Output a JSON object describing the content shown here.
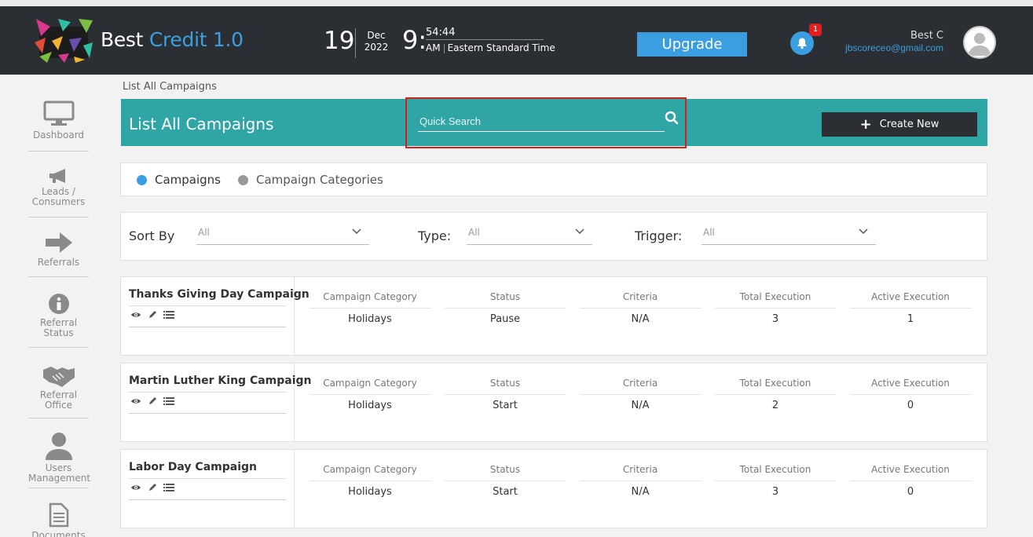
{
  "app": {
    "brand_prefix": "Best",
    "brand_accent": "Credit 1.0",
    "accent_color": "#3a9ee0",
    "teal_color": "#30a5a5"
  },
  "header": {
    "date_day": "19",
    "date_month": "Dec",
    "date_year": "2022",
    "time_hour": "9:",
    "time_min_sec": "54:44",
    "time_ampm": "AM",
    "timezone": "Eastern Standard Time",
    "upgrade_label": "Upgrade",
    "notification_count": "1",
    "user_name": "Best C",
    "user_email": "jbscoreceo@gmail.com"
  },
  "sidebar": {
    "items": [
      {
        "label_1": "Dashboard",
        "label_2": "",
        "icon": "monitor-icon"
      },
      {
        "label_1": "Leads /",
        "label_2": "Consumers",
        "icon": "megaphone-icon"
      },
      {
        "label_1": "Referrals",
        "label_2": "",
        "icon": "arrow-right-icon"
      },
      {
        "label_1": "Referral",
        "label_2": "Status",
        "icon": "info-icon"
      },
      {
        "label_1": "Referral",
        "label_2": "Office",
        "icon": "handshake-icon"
      },
      {
        "label_1": "Users",
        "label_2": "Management",
        "icon": "user-icon"
      },
      {
        "label_1": "Documents",
        "label_2": "",
        "icon": "document-icon"
      }
    ]
  },
  "breadcrumb": "List All Campaigns",
  "main": {
    "title": "List All Campaigns",
    "search_placeholder": "Quick Search",
    "create_label": "Create New",
    "tabs": [
      {
        "label": "Campaigns",
        "active": true
      },
      {
        "label": "Campaign Categories",
        "active": false
      }
    ],
    "filters": {
      "sort_label": "Sort By",
      "sort_value": "All",
      "type_label": "Type:",
      "type_value": "All",
      "trigger_label": "Trigger:",
      "trigger_value": "All"
    },
    "columns": [
      "Campaign Category",
      "Status",
      "Criteria",
      "Total Execution",
      "Active Execution"
    ],
    "campaigns": [
      {
        "name": "Thanks Giving Day Campaign",
        "category": "Holidays",
        "status": "Pause",
        "criteria": "N/A",
        "total": "3",
        "active": "1"
      },
      {
        "name": "Martin Luther King Campaign",
        "category": "Holidays",
        "status": "Start",
        "criteria": "N/A",
        "total": "2",
        "active": "0"
      },
      {
        "name": "Labor Day Campaign",
        "category": "Holidays",
        "status": "Start",
        "criteria": "N/A",
        "total": "3",
        "active": "0"
      }
    ]
  }
}
